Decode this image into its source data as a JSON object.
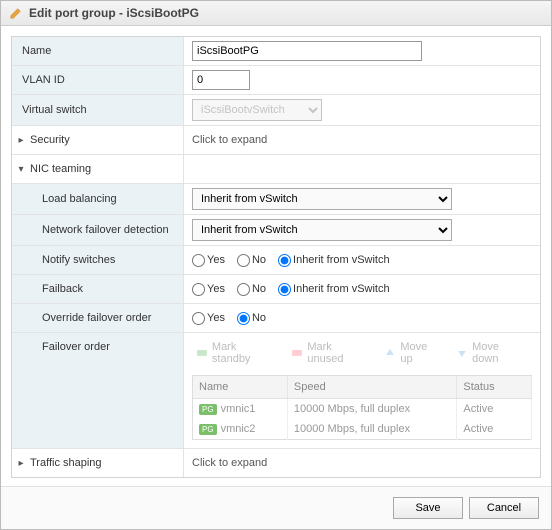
{
  "title": "Edit port group - iScsiBootPG",
  "fields": {
    "name_label": "Name",
    "name_value": "iScsiBootPG",
    "vlan_label": "VLAN ID",
    "vlan_value": "0",
    "vswitch_label": "Virtual switch",
    "vswitch_value": "iScsiBootvSwitch"
  },
  "sections": {
    "security_label": "Security",
    "security_hint": "Click to expand",
    "nic_label": "NIC teaming",
    "traffic_label": "Traffic shaping",
    "traffic_hint": "Click to expand"
  },
  "nic": {
    "lb_label": "Load balancing",
    "lb_value": "Inherit from vSwitch",
    "failover_det_label": "Network failover detection",
    "failover_det_value": "Inherit from vSwitch",
    "notify_label": "Notify switches",
    "failback_label": "Failback",
    "override_label": "Override failover order",
    "failover_order_label": "Failover order",
    "radio_yes": "Yes",
    "radio_no": "No",
    "radio_inherit": "Inherit from vSwitch"
  },
  "fo_toolbar": {
    "standby": "Mark standby",
    "unused": "Mark unused",
    "moveup": "Move up",
    "movedown": "Move down"
  },
  "fo_table": {
    "h_name": "Name",
    "h_speed": "Speed",
    "h_status": "Status",
    "rows": [
      {
        "name": "vmnic1",
        "speed": "10000 Mbps, full duplex",
        "status": "Active"
      },
      {
        "name": "vmnic2",
        "speed": "10000 Mbps, full duplex",
        "status": "Active"
      }
    ]
  },
  "buttons": {
    "save": "Save",
    "cancel": "Cancel"
  }
}
